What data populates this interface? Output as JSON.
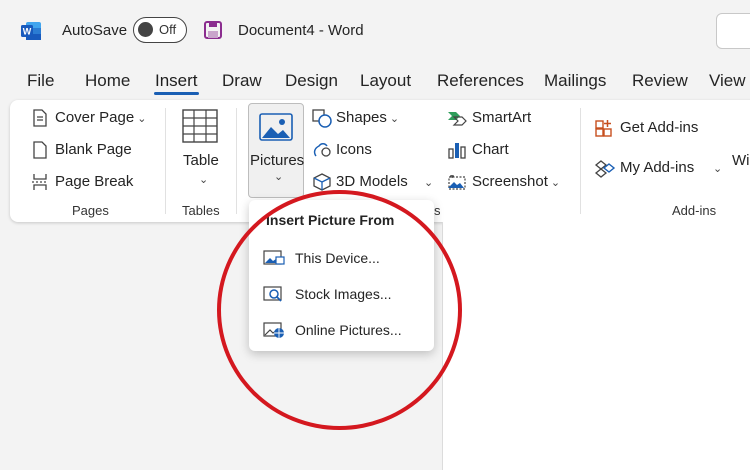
{
  "titlebar": {
    "autosave_label": "AutoSave",
    "autosave_state": "Off",
    "document_title": "Document4  -  Word",
    "accent_color": "#185abd"
  },
  "tabs": [
    {
      "label": "File"
    },
    {
      "label": "Home"
    },
    {
      "label": "Insert"
    },
    {
      "label": "Draw"
    },
    {
      "label": "Design"
    },
    {
      "label": "Layout"
    },
    {
      "label": "References"
    },
    {
      "label": "Mailings"
    },
    {
      "label": "Review"
    },
    {
      "label": "View"
    }
  ],
  "active_tab": "Insert",
  "ribbon": {
    "pages": {
      "label": "Pages",
      "cover_page": "Cover Page",
      "blank_page": "Blank Page",
      "page_break": "Page Break"
    },
    "tables": {
      "label": "Tables",
      "table": "Table"
    },
    "illustrations": {
      "pictures": "Pictures",
      "shapes": "Shapes",
      "icons": "Icons",
      "models_3d": "3D Models",
      "smartart": "SmartArt",
      "chart": "Chart",
      "screenshot": "Screenshot",
      "group_label_fragment": "s"
    },
    "addins": {
      "label": "Add-ins",
      "get_addins": "Get Add-ins",
      "my_addins": "My Add-ins",
      "wiki_fragment": "Wi"
    }
  },
  "dropdown": {
    "title": "Insert Picture From",
    "items": [
      {
        "label": "This Device..."
      },
      {
        "label": "Stock Images..."
      },
      {
        "label": "Online Pictures..."
      }
    ]
  },
  "annotation_color": "#d4181f"
}
